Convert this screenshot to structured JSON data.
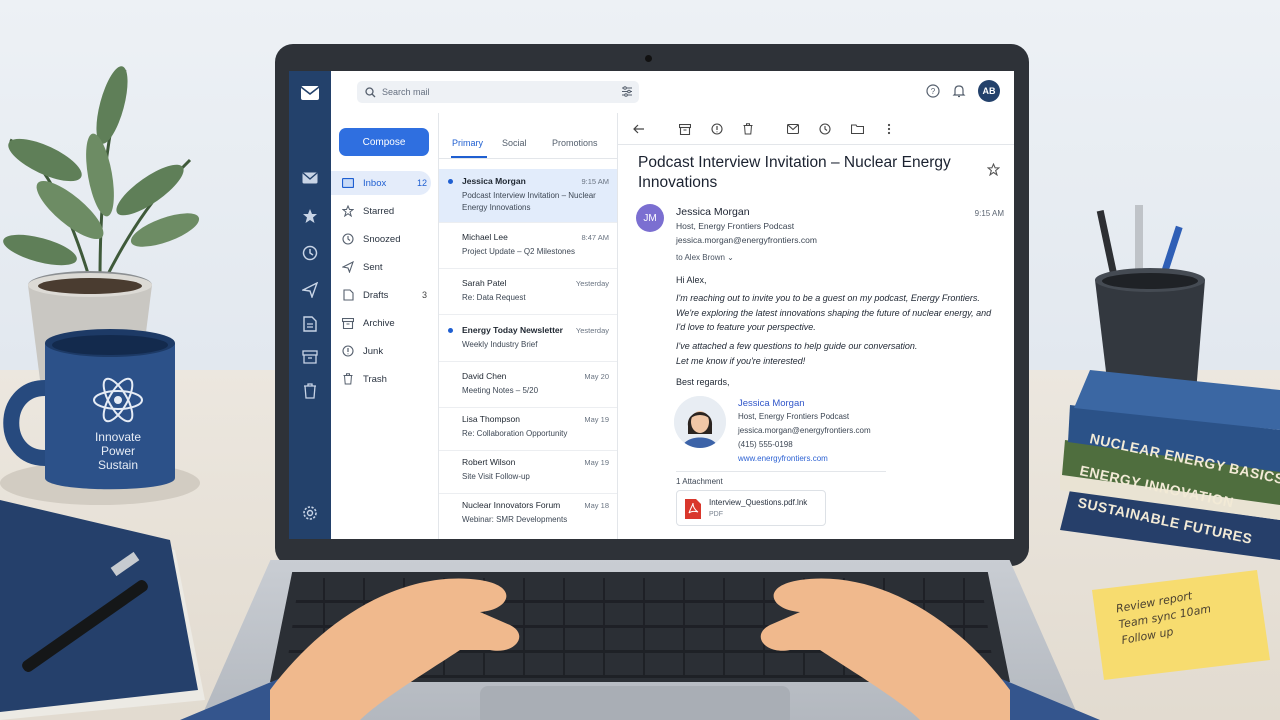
{
  "scene": {
    "mug_lines": [
      "Innovate",
      "Power",
      "Sustain"
    ],
    "books": [
      "NUCLEAR ENERGY BASICS",
      "ENERGY INNOVATION",
      "SUSTAINABLE FUTURES"
    ],
    "sticky_note": [
      "Review report",
      "Team sync 10am",
      "Follow up"
    ]
  },
  "topbar": {
    "search_placeholder": "Search mail",
    "avatar_initials": "AB"
  },
  "sidebar": {
    "compose_label": "Compose",
    "folders": [
      {
        "label": "Inbox",
        "count": "12",
        "icon": "inbox-icon"
      },
      {
        "label": "Starred",
        "count": "",
        "icon": "star-icon"
      },
      {
        "label": "Snoozed",
        "count": "",
        "icon": "clock-icon"
      },
      {
        "label": "Sent",
        "count": "",
        "icon": "send-icon"
      },
      {
        "label": "Drafts",
        "count": "3",
        "icon": "draft-icon"
      },
      {
        "label": "Archive",
        "count": "",
        "icon": "archive-icon"
      },
      {
        "label": "Junk",
        "count": "",
        "icon": "junk-icon"
      },
      {
        "label": "Trash",
        "count": "",
        "icon": "trash-icon"
      }
    ]
  },
  "list": {
    "tabs": [
      "Primary",
      "Social",
      "Promotions"
    ],
    "messages": [
      {
        "from": "Jessica Morgan",
        "time": "9:15 AM",
        "subject": "Podcast Interview Invitation – Nuclear Energy Innovations",
        "unread": true
      },
      {
        "from": "Michael Lee",
        "time": "8:47 AM",
        "subject": "Project Update – Q2 Milestones",
        "unread": false
      },
      {
        "from": "Sarah Patel",
        "time": "Yesterday",
        "subject": "Re: Data Request",
        "unread": false
      },
      {
        "from": "Energy Today Newsletter",
        "time": "Yesterday",
        "subject": "Weekly Industry Brief",
        "unread": true
      },
      {
        "from": "David Chen",
        "time": "May 20",
        "subject": "Meeting Notes – 5/20",
        "unread": false
      },
      {
        "from": "Lisa Thompson",
        "time": "May 19",
        "subject": "Re: Collaboration Opportunity",
        "unread": false
      },
      {
        "from": "Robert Wilson",
        "time": "May 19",
        "subject": "Site Visit Follow-up",
        "unread": false
      },
      {
        "from": "Nuclear Innovators Forum",
        "time": "May 18",
        "subject": "Webinar: SMR Developments",
        "unread": false
      }
    ]
  },
  "reader": {
    "subject": "Podcast Interview Invitation – Nuclear Energy Innovations",
    "avatar_initials": "JM",
    "sender_name": "Jessica Morgan",
    "sender_role": "Host, Energy Frontiers Podcast",
    "sender_email": "jessica.morgan@energyfrontiers.com",
    "time": "9:15 AM",
    "to": "to Alex Brown",
    "greeting": "Hi Alex,",
    "para1": "I'm reaching out to invite you to be a guest on my podcast, Energy Frontiers. We're exploring the latest innovations shaping the future of nuclear energy, and I'd love to feature your perspective.",
    "para2_line1": "I've attached a few questions to help guide our conversation.",
    "para2_line2": "Let me know if you're interested!",
    "closing": "Best regards,",
    "signature": {
      "name": "Jessica Morgan",
      "role": "Host, Energy Frontiers Podcast",
      "email": "jessica.morgan@energyfrontiers.com",
      "phone": "(415) 555-0198",
      "website": "www.energyfrontiers.com"
    },
    "attachment_count": "1 Attachment",
    "attachment_name": "Interview_Questions.pdf.lnk",
    "attachment_type": "PDF"
  },
  "colors": {
    "rail": "#23416b",
    "accent": "#2f6fe0",
    "selected_row": "#e2ecfb"
  }
}
